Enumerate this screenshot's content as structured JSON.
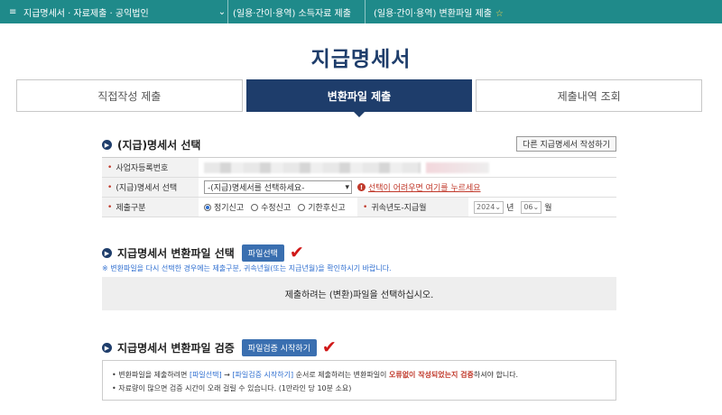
{
  "nav": {
    "menu_icon": "≡",
    "item1": "지급명세서 · 자료제출 · 공익법인",
    "chevron": "⌄",
    "item2": "(일용·간이·용역) 소득자료 제출",
    "item3": "(일용·간이·용역) 변환파일 제출",
    "star": "☆"
  },
  "page_title": "지급명세서",
  "tabs": [
    {
      "label": "직접작성 제출"
    },
    {
      "label": "변환파일 제출"
    },
    {
      "label": "제출내역 조회"
    }
  ],
  "section1": {
    "title": "(지급)명세서 선택",
    "other_button": "다른 지급명세서 작성하기",
    "rows": {
      "bizno_label": "사업자등록번호",
      "select_label": "(지급)명세서 선택",
      "select_value": "-(지급)명세서를 선택하세요-",
      "warn_text": "선택이 어려우면 여기를 누르세요",
      "submit_label": "제출구분",
      "radio1": "정기신고",
      "radio2": "수정신고",
      "radio3": "기한후신고",
      "year_label": "귀속년도-지급월",
      "year_value": "2024",
      "year_unit": "년",
      "month_value": "06",
      "month_unit": "월"
    }
  },
  "section2": {
    "title": "지급명세서 변환파일 선택",
    "button": "파일선택",
    "note": "※ 변환파일을 다시 선택한 경우에는 제출구분, 귀속년월(또는 지급년월)을 확인하시기 바랍니다.",
    "drop_text": "제출하려는 (변환)파일을 선택하십시오."
  },
  "section3": {
    "title": "지급명세서 변환파일 검증",
    "button": "파일검증 시작하기",
    "line1_a": "• 변환파일을 제출하려면 ",
    "line1_b": "[파일선택]",
    "line1_c": " → ",
    "line1_d": "[파일검증 시작하기]",
    "line1_e": " 순서로 제출하려는 변환파일이 ",
    "line1_f": "오류없이 작성되었는지 검증",
    "line1_g": "하셔야 합니다.",
    "line2": "• 자료량이 많으면 검증 시간이 오래 걸릴 수 있습니다. (1만라인 당 10분 소요)"
  },
  "icons": {
    "bullet": "arrow-right-circle-icon",
    "check": "red-check-icon",
    "warn": "exclamation-circle-icon"
  },
  "colors": {
    "nav_bg": "#1f8a8a",
    "active_tab": "#1e3d6b",
    "button_blue": "#3a6fb0",
    "warn_red": "#c0392b",
    "check_red": "#d01818"
  }
}
